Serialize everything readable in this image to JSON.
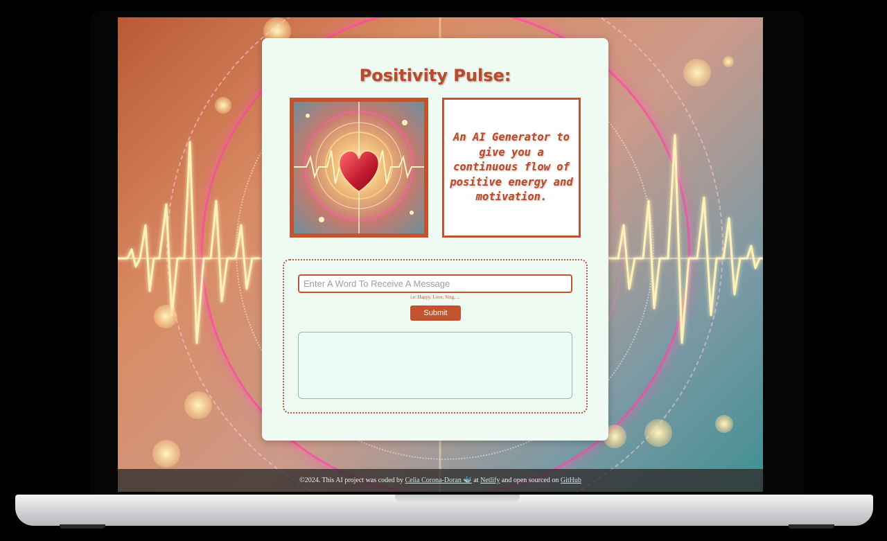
{
  "app": {
    "title": "Positivity Pulse:",
    "tagline": "An AI Generator to give you a continuous flow of positive energy and motivation."
  },
  "form": {
    "input_placeholder": "Enter A Word To Receive A Message",
    "input_value": "",
    "hint": "i.e: Happy, Love, Sing, ...",
    "submit_label": "Submit",
    "output_text": ""
  },
  "footer": {
    "prefix": "©2024. This AI project was coded by ",
    "author_link": "Celia Corona-Doran 🐳",
    "at_text": " at ",
    "host_link": "Netlify",
    "mid_text": " and open sourced on ",
    "repo_link": "GitHub"
  },
  "colors": {
    "accent": "#c2532f",
    "card_background": "#effaf3",
    "output_border": "#8cbdb3"
  },
  "icons": {
    "hero_image": "heart-pulse-icon"
  }
}
